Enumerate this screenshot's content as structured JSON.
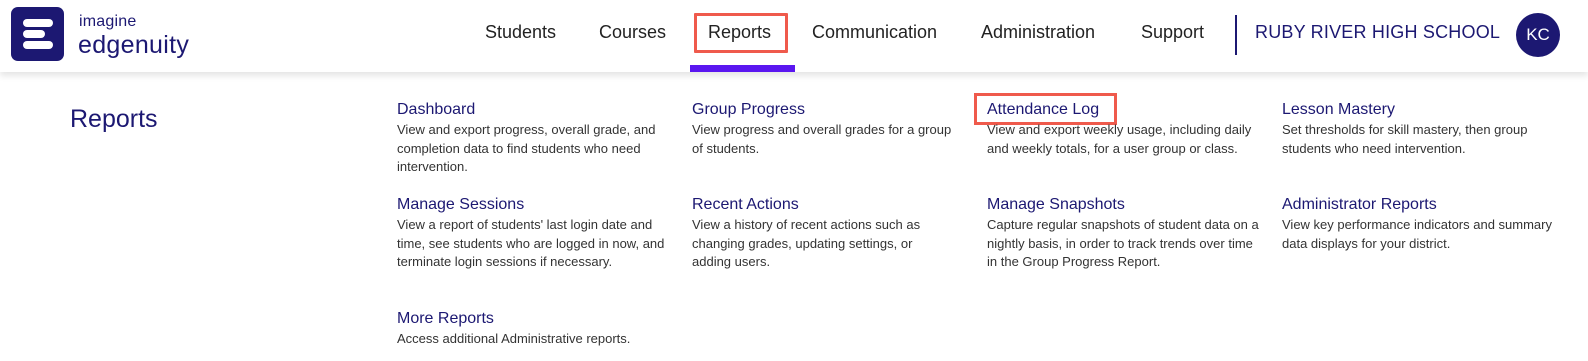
{
  "logo": {
    "top_text": "imagine",
    "main_text": "edgenuity"
  },
  "nav": {
    "students": "Students",
    "courses": "Courses",
    "reports": "Reports",
    "communication": "Communication",
    "administration": "Administration",
    "support": "Support"
  },
  "school_name": "RUBY RIVER HIGH SCHOOL",
  "user_initials": "KC",
  "panel": {
    "title": "Reports"
  },
  "reports": [
    {
      "title": "Dashboard",
      "desc": "View and export progress, overall grade, and completion data to find students who need intervention."
    },
    {
      "title": "Group Progress",
      "desc": "View progress and overall grades for a group of students."
    },
    {
      "title": "Attendance Log",
      "desc": "View and export weekly usage, including daily and weekly totals, for a user group or class."
    },
    {
      "title": "Lesson Mastery",
      "desc": "Set thresholds for skill mastery, then group students who need intervention."
    },
    {
      "title": "Manage Sessions",
      "desc": "View a report of students' last login date and time, see students who are logged in now, and terminate login sessions if necessary."
    },
    {
      "title": "Recent Actions",
      "desc": "View a history of recent actions such as changing grades, updating settings, or adding users."
    },
    {
      "title": "Manage Snapshots",
      "desc": "Capture regular snapshots of student data on a nightly basis, in order to track trends over time in the Group Progress Report."
    },
    {
      "title": "Administrator Reports",
      "desc": "View key performance indicators and summary data displays for your district."
    },
    {
      "title": "More Reports",
      "desc": "Access additional Administrative reports."
    }
  ],
  "colors": {
    "brand": "#1c1872",
    "active_underline": "#5a16f0",
    "highlight": "#ef5a4c"
  }
}
